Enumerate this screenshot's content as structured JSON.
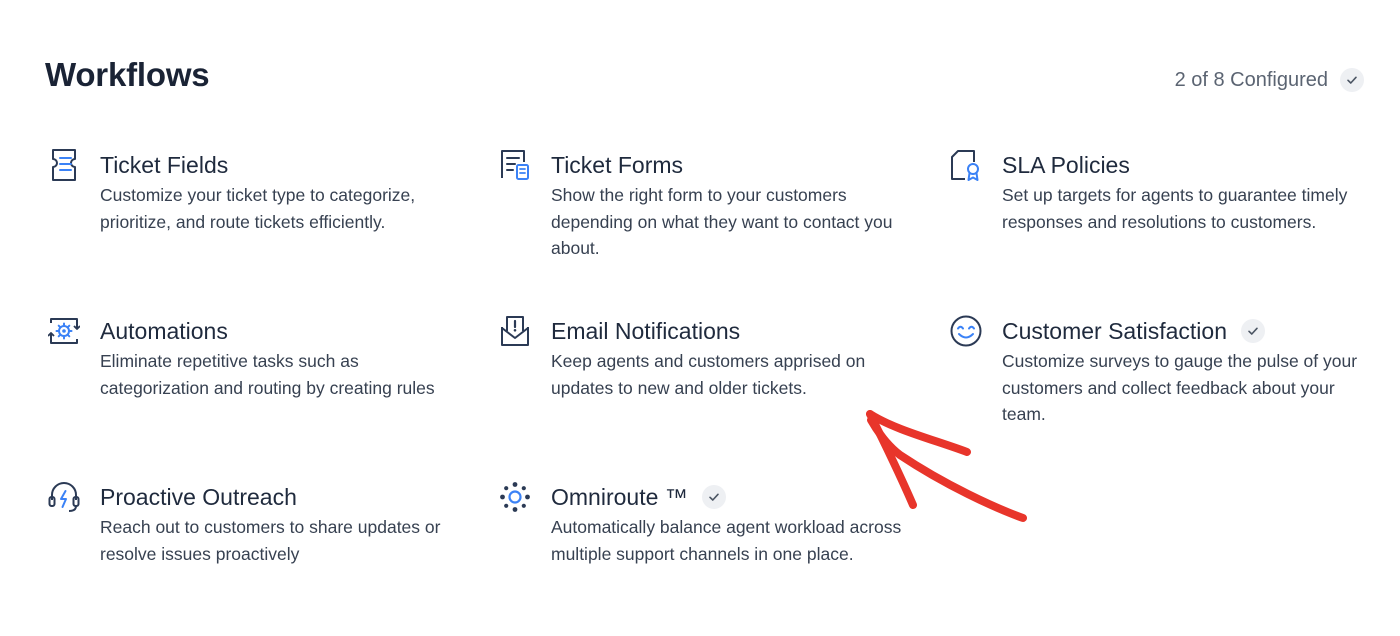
{
  "header": {
    "title": "Workflows",
    "progress_text": "2 of 8 Configured"
  },
  "cards": [
    {
      "icon": "ticket-fields-icon",
      "title": "Ticket Fields",
      "configured": false,
      "description": "Customize your ticket type to categorize, prioritize, and route tickets efficiently."
    },
    {
      "icon": "ticket-forms-icon",
      "title": "Ticket Forms",
      "configured": false,
      "description": "Show the right form to your customers depending on what they want to contact you about."
    },
    {
      "icon": "sla-policies-icon",
      "title": "SLA Policies",
      "configured": false,
      "description": "Set up targets for agents to guarantee timely responses and resolutions to customers."
    },
    {
      "icon": "automations-icon",
      "title": "Automations",
      "configured": false,
      "description": "Eliminate repetitive tasks such as categorization and routing by creating rules"
    },
    {
      "icon": "email-notifications-icon",
      "title": "Email Notifications",
      "configured": false,
      "description": "Keep agents and customers apprised on updates to new and older tickets."
    },
    {
      "icon": "customer-satisfaction-icon",
      "title": "Customer Satisfaction",
      "configured": true,
      "description": "Customize surveys to gauge the pulse of your customers and collect feedback about your team."
    },
    {
      "icon": "proactive-outreach-icon",
      "title": "Proactive Outreach",
      "configured": false,
      "description": "Reach out to customers to share updates or resolve issues proactively"
    },
    {
      "icon": "omniroute-icon",
      "title": "Omniroute ™",
      "configured": true,
      "description": "Automatically balance agent workload across multiple support channels in one place."
    }
  ],
  "annotation": {
    "arrow_color": "#e8352b",
    "points_to": "Email Notifications"
  },
  "colors": {
    "icon_stroke": "#2b3a55",
    "icon_accent": "#3b82f6",
    "badge_bg": "#eef0f3"
  }
}
